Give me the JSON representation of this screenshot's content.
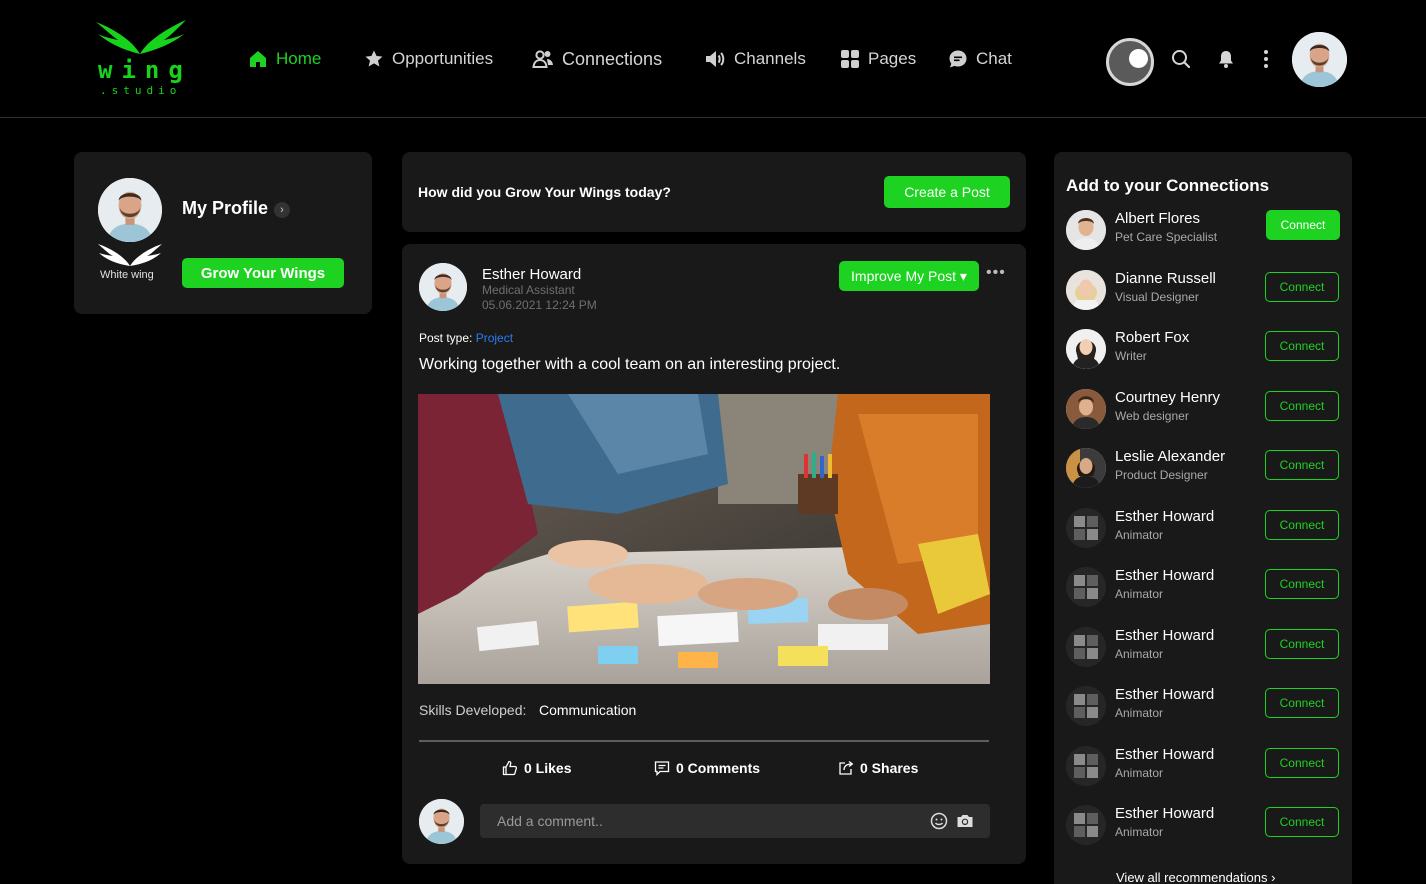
{
  "brand": {
    "name": "wing",
    "sub": ".studio",
    "color": "#18d31c"
  },
  "nav": [
    {
      "label": "Home",
      "icon": "home-icon",
      "active": true
    },
    {
      "label": "Opportunities",
      "icon": "star-icon"
    },
    {
      "label": "Connections",
      "icon": "people-icon"
    },
    {
      "label": "Channels",
      "icon": "megaphone-icon"
    },
    {
      "label": "Pages",
      "icon": "grid-icon"
    },
    {
      "label": "Chat",
      "icon": "chat-icon"
    }
  ],
  "profile": {
    "title": "My Profile",
    "badge_label": "White wing",
    "grow_label": "Grow Your Wings"
  },
  "compose": {
    "question": "How did you Grow Your Wings today?",
    "create_label": "Create a Post"
  },
  "post": {
    "author": "Esther Howard",
    "role": "Medical Assistant",
    "date": "05.06.2021   12:24 PM",
    "improve_label": "Improve My Post ▾",
    "type_label": "Post type:",
    "type_value": "Project",
    "body": "Working together with a cool team on an interesting project.",
    "skills_label": "Skills Developed:",
    "skills_value": "Communication",
    "likes": "0 Likes",
    "comments": "0 Comments",
    "shares": "0 Shares",
    "comment_placeholder": "Add a comment.."
  },
  "connections": {
    "heading": "Add to your Connections",
    "button_label": "Connect",
    "people": [
      {
        "name": "Albert Flores",
        "role": "Pet Care Specialist"
      },
      {
        "name": "Dianne Russell",
        "role": "Visual Designer"
      },
      {
        "name": "Robert Fox",
        "role": "Writer"
      },
      {
        "name": "Courtney Henry",
        "role": "Web designer"
      },
      {
        "name": "Leslie Alexander",
        "role": "Product Designer"
      },
      {
        "name": "Esther Howard",
        "role": "Animator"
      },
      {
        "name": "Esther Howard",
        "role": "Animator"
      },
      {
        "name": "Esther Howard",
        "role": "Animator"
      },
      {
        "name": "Esther Howard",
        "role": "Animator"
      },
      {
        "name": "Esther Howard",
        "role": "Animator"
      },
      {
        "name": "Esther Howard",
        "role": "Animator"
      }
    ],
    "view_all": "View all recommendations  ›"
  },
  "colors": {
    "accent": "#1ed221",
    "card": "#191919",
    "link": "#2d7cf0"
  }
}
